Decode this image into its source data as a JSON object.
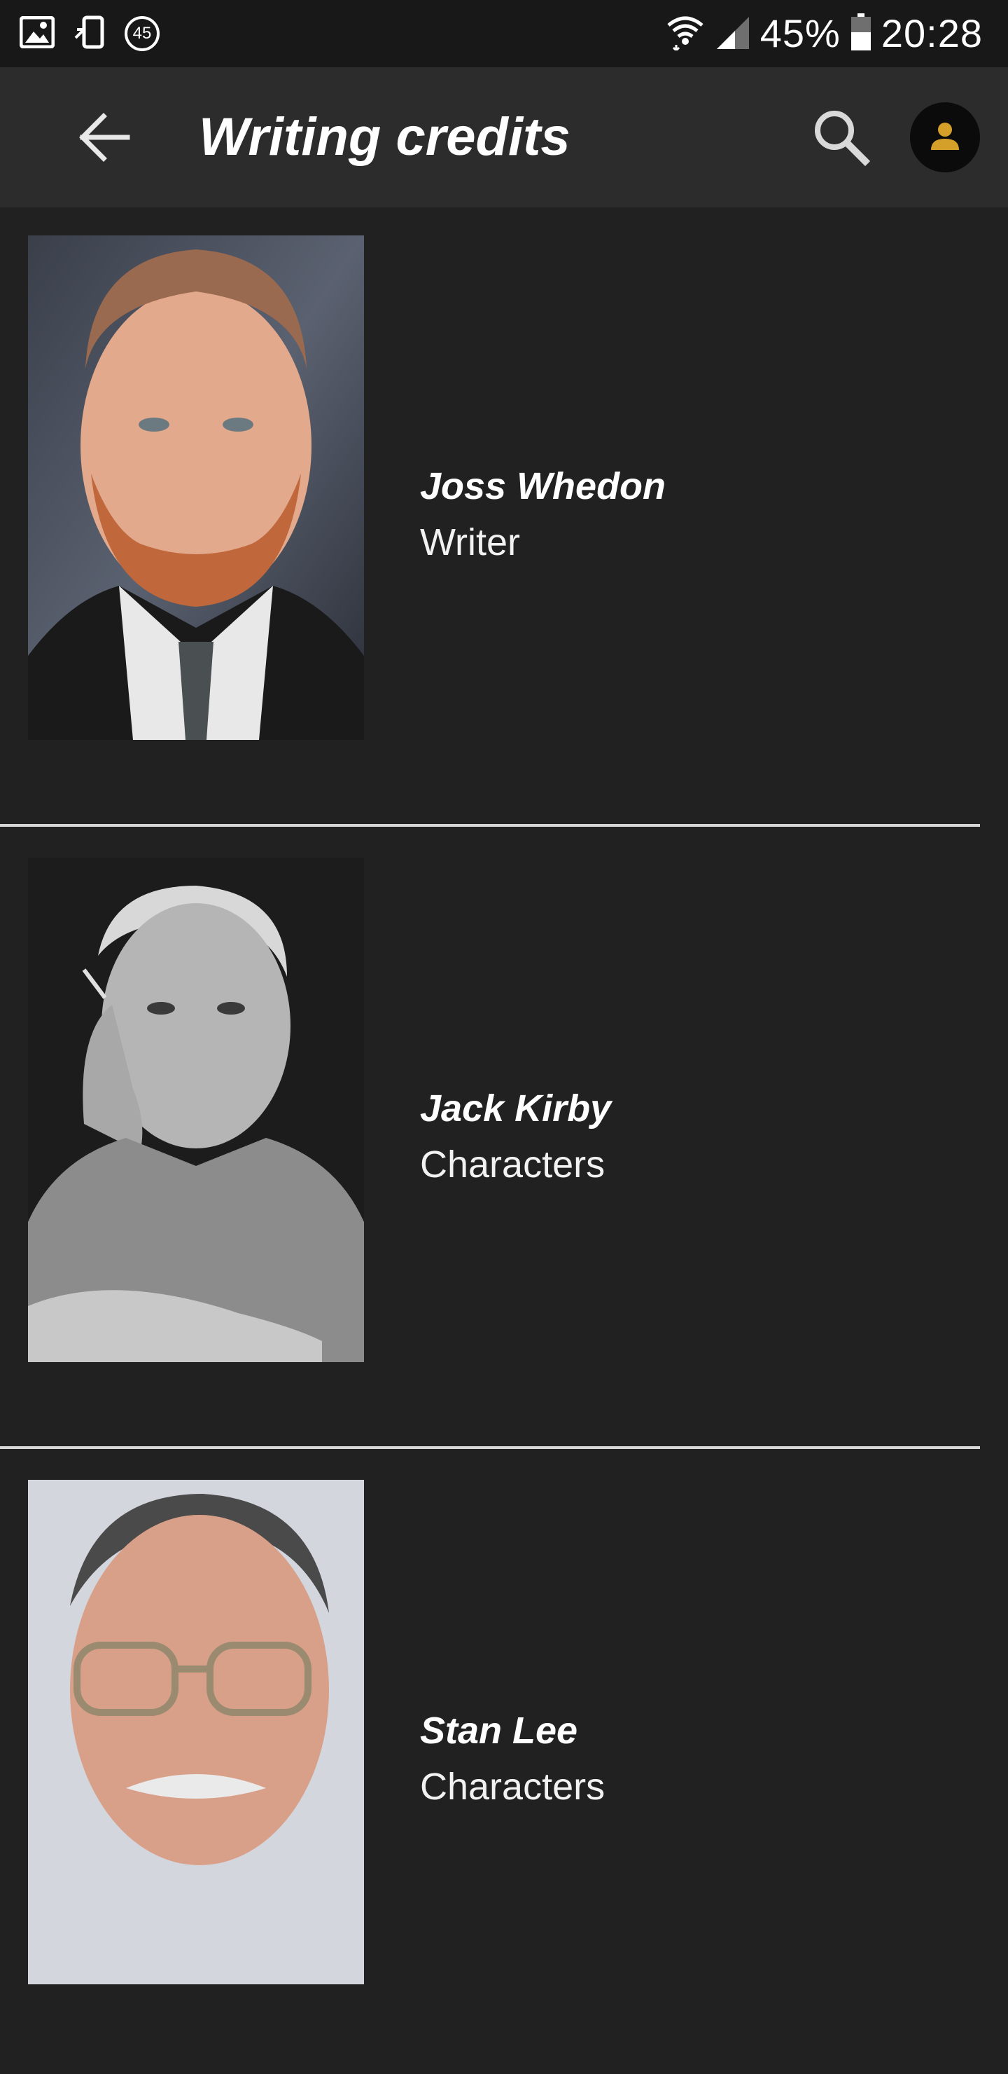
{
  "status_bar": {
    "notification_badge": "45",
    "battery": "45%",
    "time": "20:28",
    "icons": [
      "image-icon",
      "phone-sync-icon",
      "wifi-icon",
      "signal-icon",
      "battery-icon"
    ]
  },
  "app_bar": {
    "title": "Writing credits",
    "icons": [
      "back-arrow-icon",
      "search-icon",
      "account-icon"
    ],
    "accent_color": "#d4a02a"
  },
  "credits": [
    {
      "name": "Joss Whedon",
      "role": "Writer"
    },
    {
      "name": "Jack Kirby",
      "role": "Characters"
    },
    {
      "name": "Stan Lee",
      "role": "Characters"
    }
  ],
  "colors": {
    "background": "#212121",
    "app_bar": "#2c2c2c",
    "status_bar": "#181818",
    "divider": "#d6d6d6"
  }
}
